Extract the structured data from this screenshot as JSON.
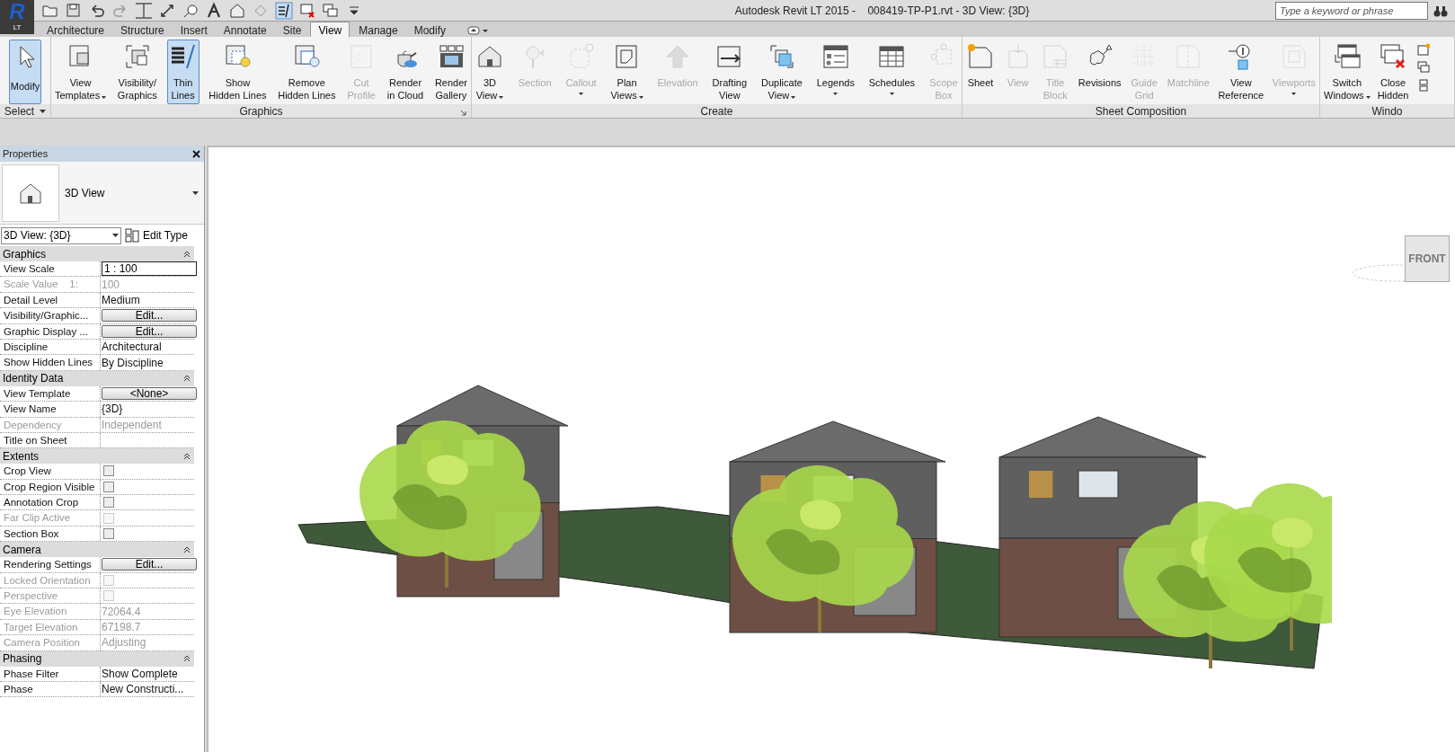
{
  "app_logo": {
    "letter": "R",
    "edition": "LT"
  },
  "window": {
    "title": "Autodesk Revit LT 2015 -    008419-TP-P1.rvt - 3D View: {3D}"
  },
  "search": {
    "placeholder": "Type a keyword or phrase"
  },
  "tabs": [
    {
      "label": "Architecture",
      "selected": false
    },
    {
      "label": "Structure",
      "selected": false
    },
    {
      "label": "Insert",
      "selected": false
    },
    {
      "label": "Annotate",
      "selected": false
    },
    {
      "label": "Site",
      "selected": false
    },
    {
      "label": "View",
      "selected": true
    },
    {
      "label": "Manage",
      "selected": false
    },
    {
      "label": "Modify",
      "selected": false
    }
  ],
  "ribbon": {
    "panels": [
      {
        "title": "Select",
        "title_dropdown": true,
        "tools": [
          {
            "lines": [
              "Modify"
            ],
            "selected": true,
            "disabled": false,
            "dropdown": false
          }
        ]
      },
      {
        "title": "Graphics",
        "launcher": true,
        "tools": [
          {
            "lines": [
              "View",
              "Templates"
            ],
            "selected": false,
            "disabled": false,
            "dropdown": true
          },
          {
            "lines": [
              "Visibility/",
              "Graphics"
            ],
            "selected": false,
            "disabled": false,
            "dropdown": false
          },
          {
            "lines": [
              "Thin",
              "Lines"
            ],
            "selected": true,
            "disabled": false,
            "dropdown": false
          },
          {
            "lines": [
              "Show",
              "Hidden Lines"
            ],
            "selected": false,
            "disabled": false,
            "dropdown": false
          },
          {
            "lines": [
              "Remove",
              "Hidden Lines"
            ],
            "selected": false,
            "disabled": false,
            "dropdown": false
          },
          {
            "lines": [
              "Cut",
              "Profile"
            ],
            "selected": false,
            "disabled": true,
            "dropdown": false
          },
          {
            "lines": [
              "Render",
              "in Cloud"
            ],
            "selected": false,
            "disabled": false,
            "dropdown": false
          },
          {
            "lines": [
              "Render",
              "Gallery"
            ],
            "selected": false,
            "disabled": false,
            "dropdown": false
          }
        ]
      },
      {
        "title": "Create",
        "tools": [
          {
            "lines": [
              "3D",
              "View"
            ],
            "selected": false,
            "disabled": false,
            "dropdown": true
          },
          {
            "lines": [
              "Section"
            ],
            "selected": false,
            "disabled": true,
            "dropdown": false
          },
          {
            "lines": [
              "Callout"
            ],
            "selected": false,
            "disabled": true,
            "dropdown": true
          },
          {
            "lines": [
              "Plan",
              "Views"
            ],
            "selected": false,
            "disabled": false,
            "dropdown": true
          },
          {
            "lines": [
              "Elevation"
            ],
            "selected": false,
            "disabled": true,
            "dropdown": false
          },
          {
            "lines": [
              "Drafting",
              "View"
            ],
            "selected": false,
            "disabled": false,
            "dropdown": false
          },
          {
            "lines": [
              "Duplicate",
              "View"
            ],
            "selected": false,
            "disabled": false,
            "dropdown": true
          },
          {
            "lines": [
              "Legends"
            ],
            "selected": false,
            "disabled": false,
            "dropdown": true
          },
          {
            "lines": [
              "Schedules"
            ],
            "selected": false,
            "disabled": false,
            "dropdown": true
          },
          {
            "lines": [
              "Scope",
              "Box"
            ],
            "selected": false,
            "disabled": true,
            "dropdown": false
          }
        ]
      },
      {
        "title": "Sheet Composition",
        "tools": [
          {
            "lines": [
              "Sheet"
            ],
            "selected": false,
            "disabled": false,
            "dropdown": false
          },
          {
            "lines": [
              "View"
            ],
            "selected": false,
            "disabled": true,
            "dropdown": false
          },
          {
            "lines": [
              "Title",
              "Block"
            ],
            "selected": false,
            "disabled": true,
            "dropdown": false
          },
          {
            "lines": [
              "Revisions"
            ],
            "selected": false,
            "disabled": false,
            "dropdown": false
          },
          {
            "lines": [
              "Guide",
              "Grid"
            ],
            "selected": false,
            "disabled": true,
            "dropdown": false
          },
          {
            "lines": [
              "Matchline"
            ],
            "selected": false,
            "disabled": true,
            "dropdown": false
          },
          {
            "lines": [
              "View",
              "Reference"
            ],
            "selected": false,
            "disabled": false,
            "dropdown": false
          },
          {
            "lines": [
              "Viewports"
            ],
            "selected": false,
            "disabled": true,
            "dropdown": true
          }
        ]
      },
      {
        "title": "Windo",
        "tools": [
          {
            "lines": [
              "Switch",
              "Windows"
            ],
            "selected": false,
            "disabled": false,
            "dropdown": true
          },
          {
            "lines": [
              "Close",
              "Hidden"
            ],
            "selected": false,
            "disabled": false,
            "dropdown": false
          }
        ]
      }
    ]
  },
  "properties": {
    "title": "Properties",
    "type_name": "3D View",
    "instance_selector": "3D View: {3D}",
    "edit_type": "Edit Type",
    "rows": [
      {
        "kind": "section",
        "label": "Graphics"
      },
      {
        "kind": "field",
        "label": "View Scale",
        "value": "1 : 100",
        "disabled": false
      },
      {
        "kind": "text",
        "label": "Scale Value    1:",
        "value": "100",
        "disabled": true
      },
      {
        "kind": "text",
        "label": "Detail Level",
        "value": "Medium",
        "disabled": false
      },
      {
        "kind": "button",
        "label": "Visibility/Graphic...",
        "value": "Edit...",
        "disabled": false
      },
      {
        "kind": "button",
        "label": "Graphic Display ...",
        "value": "Edit...",
        "disabled": false
      },
      {
        "kind": "text",
        "label": "Discipline",
        "value": "Architectural",
        "disabled": false
      },
      {
        "kind": "text",
        "label": "Show Hidden Lines",
        "value": "By Discipline",
        "disabled": false
      },
      {
        "kind": "section",
        "label": "Identity Data"
      },
      {
        "kind": "button",
        "label": "View Template",
        "value": "<None>",
        "disabled": false
      },
      {
        "kind": "text",
        "label": "View Name",
        "value": "{3D}",
        "disabled": false
      },
      {
        "kind": "text",
        "label": "Dependency",
        "value": "Independent",
        "disabled": true
      },
      {
        "kind": "text",
        "label": "Title on Sheet",
        "disabled": false
      },
      {
        "kind": "section",
        "label": "Extents"
      },
      {
        "kind": "checkbox",
        "label": "Crop View",
        "checked": false,
        "disabled": false
      },
      {
        "kind": "checkbox",
        "label": "Crop Region Visible",
        "checked": false,
        "disabled": false
      },
      {
        "kind": "checkbox",
        "label": "Annotation Crop",
        "checked": false,
        "disabled": false
      },
      {
        "kind": "checkbox",
        "label": "Far Clip Active",
        "checked": false,
        "disabled": true
      },
      {
        "kind": "checkbox",
        "label": "Section Box",
        "checked": false,
        "disabled": false
      },
      {
        "kind": "section",
        "label": "Camera"
      },
      {
        "kind": "button",
        "label": "Rendering Settings",
        "value": "Edit...",
        "disabled": false
      },
      {
        "kind": "checkbox",
        "label": "Locked Orientation",
        "checked": false,
        "disabled": true
      },
      {
        "kind": "checkbox",
        "label": "Perspective",
        "checked": false,
        "disabled": true
      },
      {
        "kind": "text",
        "label": "Eye Elevation",
        "value": "72064.4",
        "disabled": true
      },
      {
        "kind": "text",
        "label": "Target Elevation",
        "value": "67198.7",
        "disabled": true
      },
      {
        "kind": "text",
        "label": "Camera Position",
        "value": "Adjusting",
        "disabled": true
      },
      {
        "kind": "section",
        "label": "Phasing"
      },
      {
        "kind": "text",
        "label": "Phase Filter",
        "value": "Show Complete",
        "disabled": false
      },
      {
        "kind": "text",
        "label": "Phase",
        "value": "New Constructi...",
        "disabled": false
      }
    ]
  },
  "view_cube": {
    "face": "FRONT"
  }
}
